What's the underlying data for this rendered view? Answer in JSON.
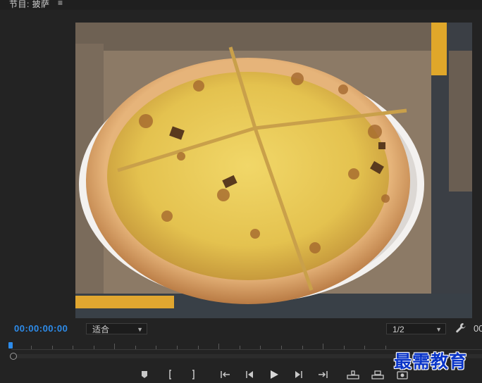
{
  "panel": {
    "title": "节目: 披萨",
    "menu_icon": "hamburger-icon"
  },
  "controls": {
    "timecode": "00:00:00:00",
    "zoom_select": "适合",
    "resolution_select": "1/2",
    "duration_partial": "00"
  },
  "transport": {
    "buttons": [
      "marker-icon",
      "mark-in-icon",
      "mark-out-icon",
      "go-to-in-icon",
      "step-back-icon",
      "play-icon",
      "step-forward-icon",
      "go-to-out-icon",
      "lift-icon",
      "extract-icon",
      "export-frame-icon"
    ]
  },
  "watermark": {
    "text": "最需教育"
  },
  "colors": {
    "accent": "#2d8ceb",
    "panel_bg": "#232323",
    "watermark": "#0a35c8"
  }
}
